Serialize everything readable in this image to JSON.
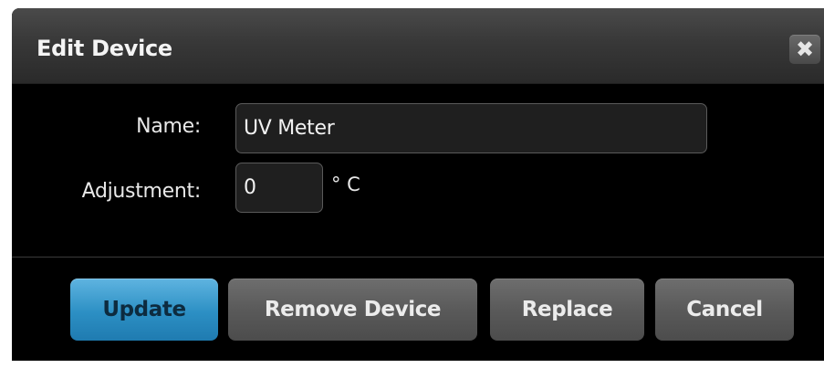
{
  "dialog": {
    "title": "Edit Device",
    "close_glyph": "✖",
    "close_icon": "close-icon"
  },
  "form": {
    "name_label": "Name:",
    "name_value": "UV Meter",
    "adjustment_label": "Adjustment:",
    "adjustment_value": "0",
    "adjustment_unit": "° C"
  },
  "buttons": {
    "update": "Update",
    "remove": "Remove Device",
    "replace": "Replace",
    "cancel": "Cancel"
  },
  "colors": {
    "background": "#000000",
    "title_bar": "#3a3a3a",
    "primary_button": "#2c8fc4",
    "secondary_button": "#5a5a5a"
  }
}
